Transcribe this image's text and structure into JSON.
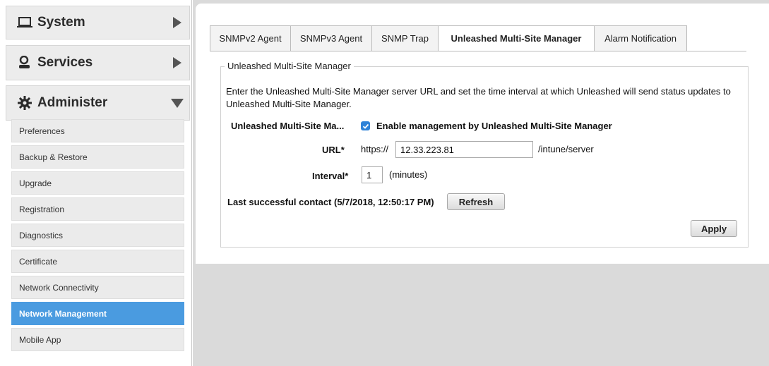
{
  "sidebar": {
    "system": {
      "label": "System",
      "icon": "laptop-icon"
    },
    "services": {
      "label": "Services",
      "icon": "services-icon"
    },
    "administer": {
      "label": "Administer",
      "icon": "gear-icon"
    },
    "items": [
      {
        "label": "Preferences"
      },
      {
        "label": "Backup & Restore"
      },
      {
        "label": "Upgrade"
      },
      {
        "label": "Registration"
      },
      {
        "label": "Diagnostics"
      },
      {
        "label": "Certificate"
      },
      {
        "label": "Network Connectivity"
      },
      {
        "label": "Network Management"
      },
      {
        "label": "Mobile App"
      }
    ],
    "active_item": "Network Management",
    "active_color": "#4a9be0"
  },
  "tabs": [
    {
      "label": "SNMPv2 Agent"
    },
    {
      "label": "SNMPv3 Agent"
    },
    {
      "label": "SNMP Trap"
    },
    {
      "label": "Unleashed Multi-Site Manager"
    },
    {
      "label": "Alarm Notification"
    }
  ],
  "active_tab": "Unleashed Multi-Site Manager",
  "form": {
    "legend": "Unleashed Multi-Site Manager",
    "description": "Enter the Unleashed Multi-Site Manager server URL and set the time interval at which Unleashed will send status updates to Unleashed Multi-Site Manager.",
    "manage_label": "Unleashed Multi-Site Ma...",
    "enable_label": "Enable management by Unleashed Multi-Site Manager",
    "enable_checked": true,
    "url_label": "URL*",
    "url_prefix": "https://",
    "url_value": "12.33.223.81",
    "url_suffix": "/intune/server",
    "interval_label": "Interval*",
    "interval_value": "1",
    "interval_unit": "(minutes)",
    "last_contact": "Last successful contact (5/7/2018, 12:50:17 PM)",
    "refresh_label": "Refresh",
    "apply_label": "Apply"
  }
}
